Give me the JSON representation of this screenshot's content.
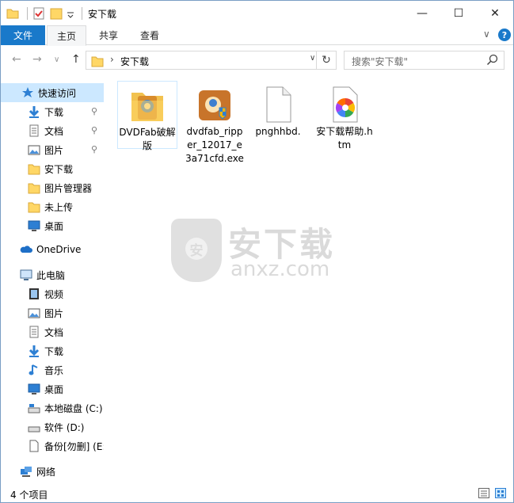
{
  "window": {
    "title": "安下载"
  },
  "title_controls": {
    "minimize": "—",
    "maximize": "☐",
    "close": "✕"
  },
  "ribbon": {
    "file_tab": "文件",
    "tabs": [
      "主页",
      "共享",
      "查看"
    ],
    "collapse_chevron": "∨",
    "help": "?"
  },
  "address": {
    "path": "安下载",
    "chevron": "›",
    "dropdown": "∨",
    "refresh": "↻",
    "search_placeholder": "搜索\"安下载\""
  },
  "nav_buttons": {
    "back": "←",
    "forward": "→",
    "recent": "∨",
    "up": "↑"
  },
  "sidebar": {
    "quick_access": "快速访问",
    "quick_items": [
      {
        "label": "下载",
        "icon": "download-icon",
        "pinned": true
      },
      {
        "label": "文档",
        "icon": "document-icon",
        "pinned": true
      },
      {
        "label": "图片",
        "icon": "picture-icon",
        "pinned": true
      },
      {
        "label": "安下载",
        "icon": "folder-icon",
        "pinned": false
      },
      {
        "label": "图片管理器",
        "icon": "folder-icon",
        "pinned": false
      },
      {
        "label": "未上传",
        "icon": "folder-icon",
        "pinned": false
      },
      {
        "label": "桌面",
        "icon": "desktop-icon",
        "pinned": false
      }
    ],
    "onedrive": "OneDrive",
    "this_pc": "此电脑",
    "pc_items": [
      {
        "label": "视频",
        "icon": "video-icon"
      },
      {
        "label": "图片",
        "icon": "picture-icon"
      },
      {
        "label": "文档",
        "icon": "document-icon"
      },
      {
        "label": "下载",
        "icon": "download-icon"
      },
      {
        "label": "音乐",
        "icon": "music-icon"
      },
      {
        "label": "桌面",
        "icon": "desktop-icon"
      },
      {
        "label": "本地磁盘 (C:)",
        "icon": "drive-icon"
      },
      {
        "label": "软件 (D:)",
        "icon": "drive-icon"
      },
      {
        "label": "备份[勿删] (E:",
        "icon": "drive-icon"
      }
    ],
    "network": "网络",
    "pin_glyph": "📌"
  },
  "files": [
    {
      "name": "DVDFab破解版",
      "icon": "dvdfab-folder-icon"
    },
    {
      "name": "dvdfab_ripper_12017_e3a71cfd.exe",
      "icon": "installer-icon"
    },
    {
      "name": "pnghhbd.",
      "icon": "blank-file-icon"
    },
    {
      "name": "安下载帮助.htm",
      "icon": "htm-file-icon"
    }
  ],
  "watermark": {
    "cn": "安下载",
    "en": "anxz.com",
    "shield": "安"
  },
  "status": {
    "count": "4 个项目"
  },
  "colors": {
    "accent": "#1979ca",
    "selected": "#cce8ff",
    "folder": "#ffd766"
  }
}
